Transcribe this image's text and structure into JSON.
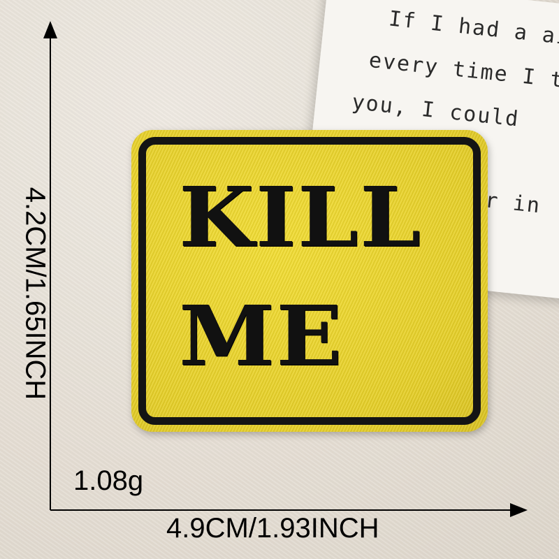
{
  "note_card": {
    "lines": [
      "If I had a ain",
      "every time I th",
      "you, I could",
      "er in"
    ]
  },
  "patch": {
    "line1": "KILL",
    "line2": "ME",
    "fill_color": "#e9d32d",
    "border_color": "#141414"
  },
  "dimensions": {
    "height_label": "4.2CM/1.65INCH",
    "width_label": "4.9CM/1.93INCH",
    "weight_label": "1.08g"
  }
}
